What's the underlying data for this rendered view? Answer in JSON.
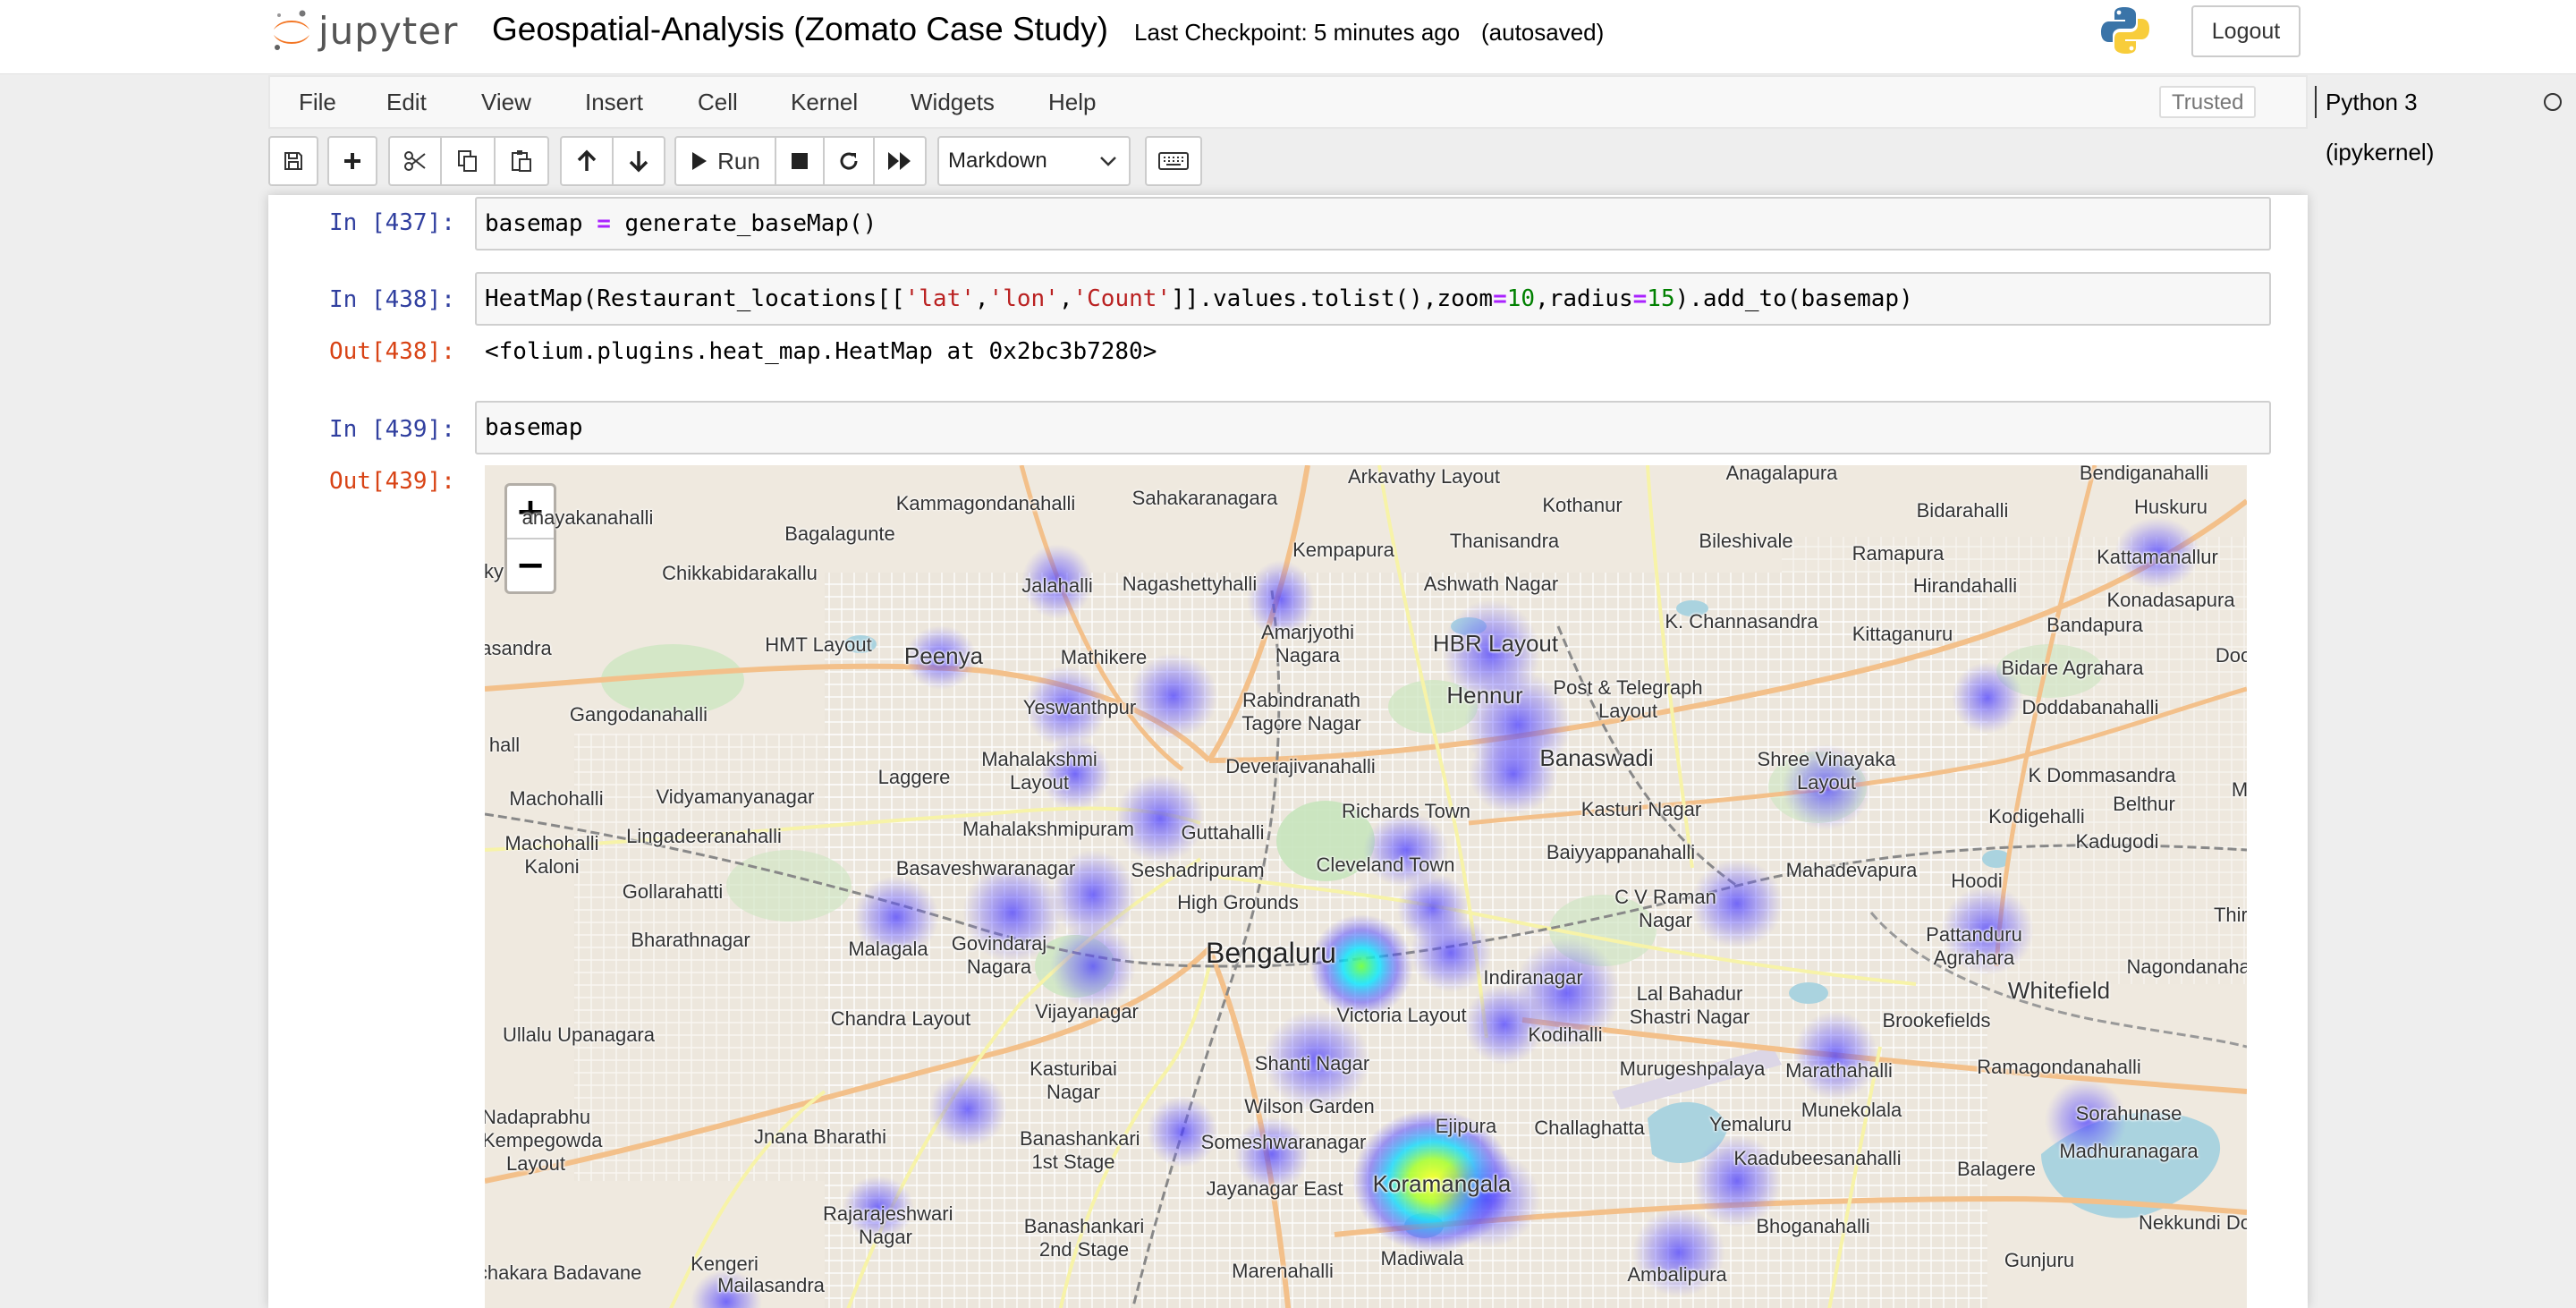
{
  "header": {
    "logo_text": "jupyter",
    "notebook_title": "Geospatial-Analysis (Zomato Case Study)",
    "checkpoint": "Last Checkpoint: 5 minutes ago",
    "autosave_status": "(autosaved)",
    "logout_label": "Logout"
  },
  "menubar": {
    "items": [
      "File",
      "Edit",
      "View",
      "Insert",
      "Cell",
      "Kernel",
      "Widgets",
      "Help"
    ],
    "trusted_label": "Trusted",
    "kernel_name": "Python 3 (ipykernel)"
  },
  "toolbar": {
    "run_label": "Run",
    "cell_type": "Markdown",
    "icons": [
      "save-icon",
      "plus-icon",
      "cut-icon",
      "copy-icon",
      "paste-icon",
      "arrow-up-icon",
      "arrow-down-icon",
      "play-icon",
      "stop-icon",
      "restart-icon",
      "fast-forward-icon",
      "keyboard-icon"
    ]
  },
  "cells": [
    {
      "in_prompt": "In [437]:",
      "code": "basemap = generate_baseMap()"
    },
    {
      "in_prompt": "In [438]:",
      "code": "HeatMap(Restaurant_locations[['lat','lon','Count']].values.tolist(),zoom=10,radius=15).add_to(basemap)",
      "out_prompt": "Out[438]:",
      "output": "<folium.plugins.heat_map.HeatMap at 0x2bc3b7280>"
    },
    {
      "in_prompt": "In [439]:",
      "code": "basemap",
      "out_prompt": "Out[439]:"
    }
  ],
  "map": {
    "zoom_in": "+",
    "zoom_out": "−",
    "places": [
      {
        "name": "Arkavathy Layout"
      },
      {
        "name": "Anagalapura"
      },
      {
        "name": "Bendiganahalli"
      },
      {
        "name": "Kammagondanahalli"
      },
      {
        "name": "Sahakaranagara"
      },
      {
        "name": "Kothanur"
      },
      {
        "name": "Bidarahalli"
      },
      {
        "name": "Huskuru"
      },
      {
        "name": "anayakanahalli"
      },
      {
        "name": "Bagalagunte"
      },
      {
        "name": "Kempapura"
      },
      {
        "name": "Thanisandra"
      },
      {
        "name": "Bileshivale"
      },
      {
        "name": "Ramapura"
      },
      {
        "name": "ky"
      },
      {
        "name": "Chikkabidarakallu"
      },
      {
        "name": "Jalahalli"
      },
      {
        "name": "Nagashettyhalli"
      },
      {
        "name": "Ashwath Nagar"
      },
      {
        "name": "Hirandahalli"
      },
      {
        "name": "Kattamanallur"
      },
      {
        "name": "Konadasapura"
      },
      {
        "name": "Amarjyothi Nagara"
      },
      {
        "name": "K. Channasandra"
      },
      {
        "name": "Kittaganuru"
      },
      {
        "name": "Bandapura"
      },
      {
        "name": "asandra"
      },
      {
        "name": "HMT Layout"
      },
      {
        "name": "Peenya"
      },
      {
        "name": "Mathikere"
      },
      {
        "name": "HBR Layout"
      },
      {
        "name": "Bidare Agrahara"
      },
      {
        "name": "Doo"
      },
      {
        "name": "Rabindranath Tagore Nagar"
      },
      {
        "name": "Hennur"
      },
      {
        "name": "Post & Telegraph Layout"
      },
      {
        "name": "Gangodanahalli"
      },
      {
        "name": "Yeswanthpur"
      },
      {
        "name": "Doddabanahalli"
      },
      {
        "name": "hall"
      },
      {
        "name": "Mahalakshmi Layout"
      },
      {
        "name": "Deverajivanahalli"
      },
      {
        "name": "Banaswadi"
      },
      {
        "name": "Shree Vinayaka Layout"
      },
      {
        "name": "Laggere"
      },
      {
        "name": "K Dommasandra"
      },
      {
        "name": "Machohalli"
      },
      {
        "name": "Vidyamanyanagar"
      },
      {
        "name": "Richards Town"
      },
      {
        "name": "Kasturi Nagar"
      },
      {
        "name": "Belthur"
      },
      {
        "name": "Kodigehalli"
      },
      {
        "name": "M"
      },
      {
        "name": "Machohalli Kaloni"
      },
      {
        "name": "Lingadeeranahalli"
      },
      {
        "name": "Mahalakshmipuram"
      },
      {
        "name": "Guttahalli"
      },
      {
        "name": "Baiyyappanahalli"
      },
      {
        "name": "Kadugodi"
      },
      {
        "name": "Basaveshwaranagar"
      },
      {
        "name": "Seshadripuram"
      },
      {
        "name": "Cleveland Town"
      },
      {
        "name": "Mahadevapura"
      },
      {
        "name": "Gollarahatti"
      },
      {
        "name": "High Grounds"
      },
      {
        "name": "Hoodi"
      },
      {
        "name": "C V Raman Nagar"
      },
      {
        "name": "Thiru"
      },
      {
        "name": "Bharathnagar"
      },
      {
        "name": "Malagala"
      },
      {
        "name": "Govindaraj Nagara"
      },
      {
        "name": "Bengaluru"
      },
      {
        "name": "Pattanduru Agrahara"
      },
      {
        "name": "Indiranagar"
      },
      {
        "name": "Whitefield"
      },
      {
        "name": "Nagondanahalli"
      },
      {
        "name": "Lal Bahadur Shastri Nagar"
      },
      {
        "name": "Chandra Layout"
      },
      {
        "name": "Vijayanagar"
      },
      {
        "name": "Ullalu Upanagara"
      },
      {
        "name": "Victoria Layout"
      },
      {
        "name": "Brookefields"
      },
      {
        "name": "Kodihalli"
      },
      {
        "name": "Kasturibai Nagar"
      },
      {
        "name": "Shanti Nagar"
      },
      {
        "name": "Murugeshpalaya"
      },
      {
        "name": "Marathahalli"
      },
      {
        "name": "Ramagondanahalli"
      },
      {
        "name": "Wilson Garden"
      },
      {
        "name": "Nadaprabhu Kempegowda Layout"
      },
      {
        "name": "Jnana Bharathi"
      },
      {
        "name": "Banashankari 1st Stage"
      },
      {
        "name": "Someshwaranagar"
      },
      {
        "name": "Ejipura"
      },
      {
        "name": "Challaghatta"
      },
      {
        "name": "Yemaluru"
      },
      {
        "name": "Munekolala"
      },
      {
        "name": "Sorahunase"
      },
      {
        "name": "Madhuranagara"
      },
      {
        "name": "Kaadubeesanahalli"
      },
      {
        "name": "Balagere"
      },
      {
        "name": "Koramangala"
      },
      {
        "name": "Jayanagar East"
      },
      {
        "name": "Rajarajeshwari Nagar"
      },
      {
        "name": "Banashankari 2nd Stage"
      },
      {
        "name": "Bhoganahalli"
      },
      {
        "name": "Nekkundi Do"
      },
      {
        "name": "Kengeri"
      },
      {
        "name": "Madiwala"
      },
      {
        "name": "Gunjuru"
      },
      {
        "name": "Marenahalli"
      },
      {
        "name": "rchakara Badavane"
      },
      {
        "name": "Mailasandra"
      },
      {
        "name": "Ambalipura"
      }
    ],
    "heat_colors": {
      "low": "#3b3bff",
      "mid": "#00e5ff",
      "high": "#ffff00"
    }
  }
}
